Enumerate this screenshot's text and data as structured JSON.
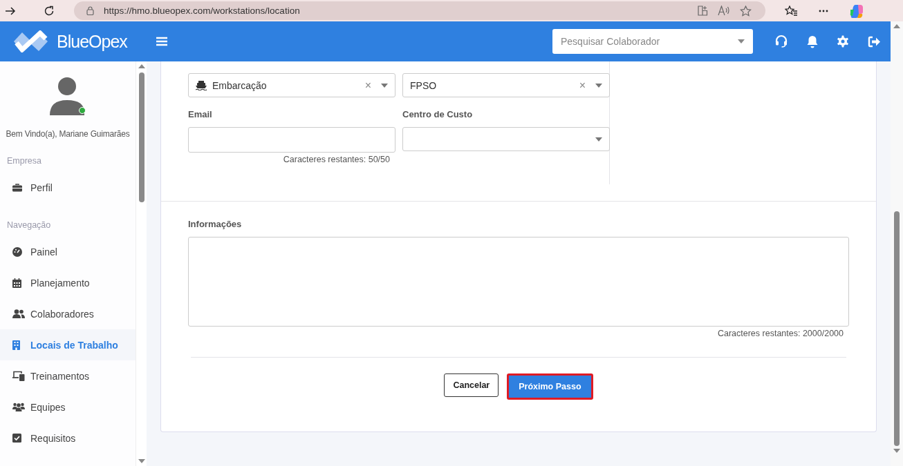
{
  "browser": {
    "url": "https://hmo.blueopex.com/workstations/location"
  },
  "header": {
    "brand": "BlueOpex",
    "search": {
      "placeholder": "Pesquisar Colaborador"
    }
  },
  "sidebar": {
    "greeting": "Bem Vindo(a), Mariane Guimarães",
    "online": true,
    "sections": [
      {
        "title": "Empresa",
        "items": [
          {
            "label": "Perfil",
            "selected": false
          }
        ]
      },
      {
        "title": "Navegação",
        "items": [
          {
            "label": "Painel",
            "selected": false
          },
          {
            "label": "Planejamento",
            "selected": false
          },
          {
            "label": "Colaboradores",
            "selected": false
          },
          {
            "label": "Locais de Trabalho",
            "selected": true
          },
          {
            "label": "Treinamentos",
            "selected": false
          },
          {
            "label": "Equipes",
            "selected": false
          },
          {
            "label": "Requisitos",
            "selected": false
          }
        ]
      }
    ]
  },
  "form": {
    "selects": [
      {
        "value": "Embarcação",
        "clear": "×"
      },
      {
        "value": "FPSO",
        "clear": "×"
      }
    ],
    "email": {
      "label": "Email",
      "counter": "Caracteres restantes: 50/50"
    },
    "cost_center": {
      "label": "Centro de Custo"
    },
    "info": {
      "label": "Informações",
      "counter": "Caracteres restantes: 2000/2000"
    },
    "buttons": [
      {
        "label": "Cancelar",
        "kind": "secondary",
        "highlighted": false
      },
      {
        "label": "Próximo Passo",
        "kind": "primary",
        "highlighted": true
      }
    ]
  }
}
